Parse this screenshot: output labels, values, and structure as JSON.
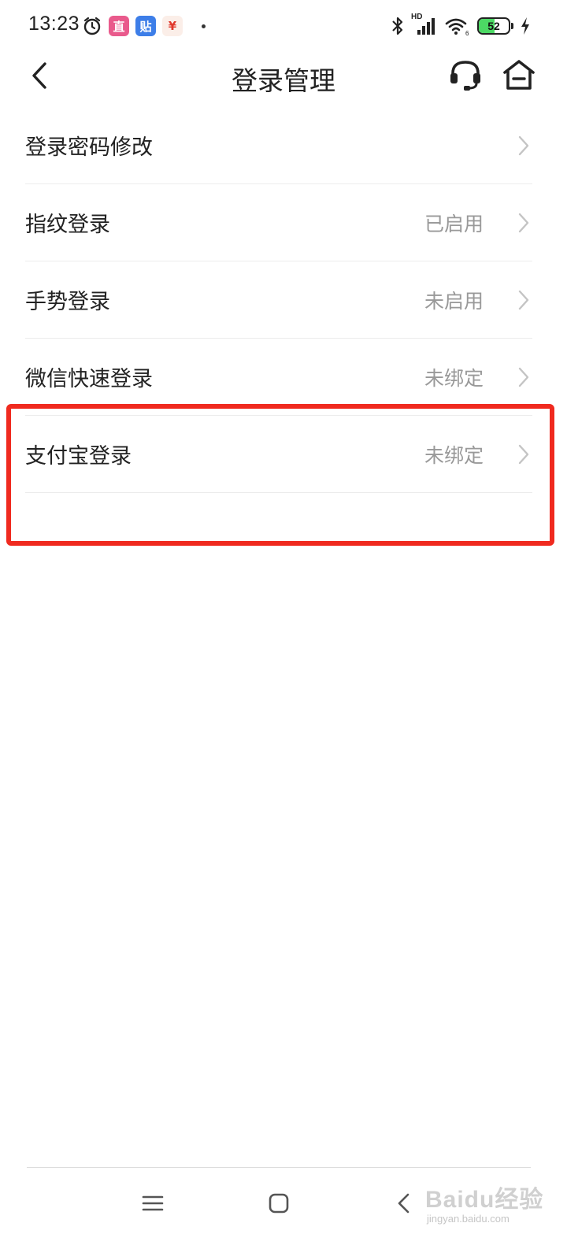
{
  "status_bar": {
    "time": "13:23",
    "app_icons": [
      "直",
      "贴",
      "¥"
    ],
    "battery_level": "52",
    "network_label": "HD"
  },
  "nav": {
    "title": "登录管理"
  },
  "menu": {
    "items": [
      {
        "label": "登录密码修改",
        "value": ""
      },
      {
        "label": "指纹登录",
        "value": "已启用"
      },
      {
        "label": "手势登录",
        "value": "未启用"
      },
      {
        "label": "微信快速登录",
        "value": "未绑定"
      },
      {
        "label": "支付宝登录",
        "value": "未绑定"
      }
    ]
  },
  "watermark": {
    "main": "Baidu经验",
    "sub": "jingyan.baidu.com"
  },
  "colors": {
    "highlight": "#f02a1f",
    "secondary_text": "#999999",
    "divider": "#ececec"
  },
  "icons": {
    "back": "chevron-left-icon",
    "service": "headset-icon",
    "home": "home-icon",
    "row_arrow": "chevron-right-icon"
  }
}
